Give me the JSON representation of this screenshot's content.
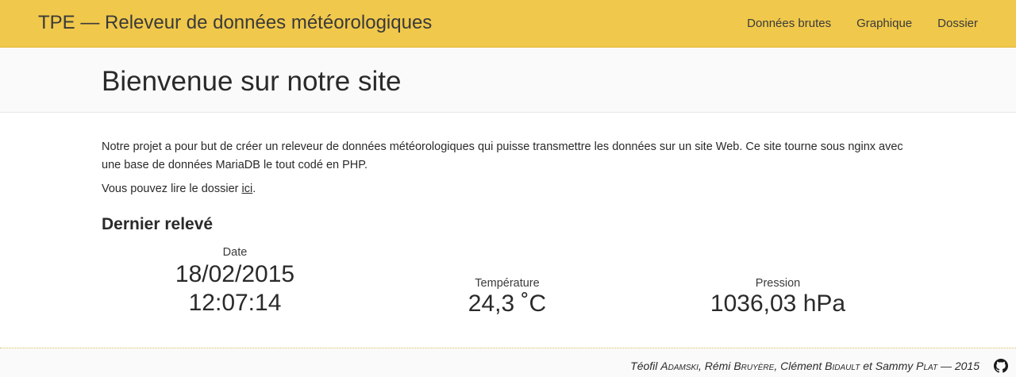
{
  "header": {
    "brand": "TPE — Releveur de données météorologiques",
    "nav": [
      "Données brutes",
      "Graphique",
      "Dossier"
    ]
  },
  "hero": {
    "title": "Bienvenue sur notre site"
  },
  "intro": {
    "paragraph": "Notre projet a pour but de créer un releveur de données météorologiques qui puisse transmettre les données sur un site Web. Ce site tourne sous nginx avec une base de données MariaDB le tout codé en PHP.",
    "dossier_prefix": "Vous pouvez lire le dossier ",
    "dossier_link": "ici",
    "dossier_suffix": "."
  },
  "last_reading": {
    "title": "Dernier relevé",
    "date_label": "Date",
    "date": "18/02/2015",
    "time": "12:07:14",
    "temperature_label": "Température",
    "temperature": "24,3 ˚C",
    "pressure_label": "Pression",
    "pressure": "1036,03 hPa"
  },
  "footer": {
    "a1_first": "Téofil ",
    "a1_last": "Adamski",
    "sep1": ", ",
    "a2_first": "Rémi ",
    "a2_last": "Bruyère",
    "sep2": ", ",
    "a3_first": "Clément ",
    "a3_last": "Bidault",
    "sep3": " et ",
    "a4_first": "Sammy ",
    "a4_last": "Plat",
    "year": " — 2015"
  },
  "colors": {
    "navbar": "#f0c84b",
    "text": "#2a2a2a"
  }
}
